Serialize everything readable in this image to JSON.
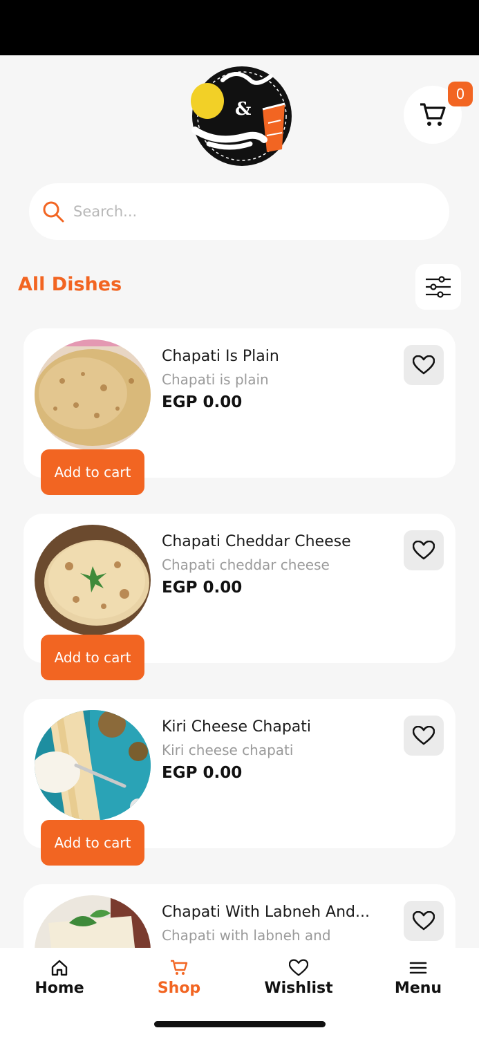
{
  "header": {
    "cart_count": "0"
  },
  "search": {
    "placeholder": "Search..."
  },
  "section": {
    "title": "All Dishes"
  },
  "dishes": [
    {
      "name": "Chapati Is Plain",
      "description": "Chapati is plain",
      "price": "EGP 0.00",
      "add_label": "Add to cart"
    },
    {
      "name": "Chapati Cheddar Cheese",
      "description": "Chapati cheddar cheese",
      "price": "EGP 0.00",
      "add_label": "Add to cart"
    },
    {
      "name": "Kiri Cheese Chapati",
      "description": "Kiri cheese chapati",
      "price": "EGP 0.00",
      "add_label": "Add to cart"
    },
    {
      "name": "Chapati With Labneh And...",
      "description": "Chapati with labneh and"
    }
  ],
  "nav": {
    "items": [
      {
        "label": "Home",
        "icon": "home-icon"
      },
      {
        "label": "Shop",
        "icon": "cart-icon",
        "active": true
      },
      {
        "label": "Wishlist",
        "icon": "heart-icon"
      },
      {
        "label": "Menu",
        "icon": "menu-icon"
      }
    ]
  },
  "colors": {
    "accent": "#f26522",
    "background": "#f6f6f6"
  }
}
